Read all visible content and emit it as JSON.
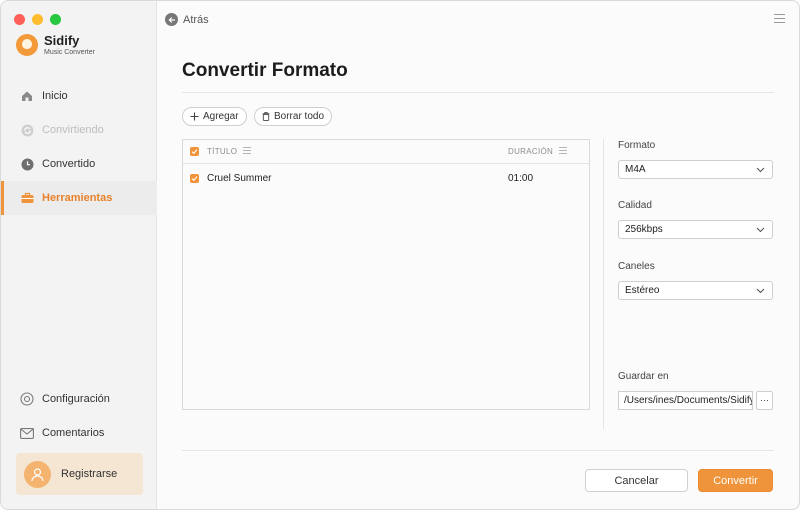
{
  "app": {
    "name": "Sidify",
    "subtitle": "Music Converter"
  },
  "sidebar": {
    "items": [
      {
        "label": "Inicio",
        "icon": "home-icon",
        "state": "normal"
      },
      {
        "label": "Convirtiendo",
        "icon": "sync-icon",
        "state": "disabled"
      },
      {
        "label": "Convertido",
        "icon": "clock-icon",
        "state": "normal"
      },
      {
        "label": "Herramientas",
        "icon": "toolbox-icon",
        "state": "active"
      }
    ],
    "bottom_items": [
      {
        "label": "Configuración",
        "icon": "gear-icon"
      },
      {
        "label": "Comentarios",
        "icon": "mail-icon"
      }
    ],
    "register_label": "Registrarse"
  },
  "topbar": {
    "back_label": "Atrás"
  },
  "page": {
    "title": "Convertir Formato"
  },
  "toolbar": {
    "add_label": "Agregar",
    "clear_label": "Borrar todo"
  },
  "table": {
    "headers": {
      "title": "TÍTULO",
      "duration": "DURACIÓN"
    },
    "rows": [
      {
        "title": "Cruel Summer",
        "duration": "01:00",
        "checked": true
      }
    ]
  },
  "settings": {
    "format": {
      "label": "Formato",
      "value": "M4A"
    },
    "quality": {
      "label": "Calidad",
      "value": "256kbps"
    },
    "channels": {
      "label": "Caneles",
      "value": "Estéreo"
    },
    "output": {
      "label": "Guardar en",
      "value": "/Users/ines/Documents/Sidify",
      "browse_label": "···"
    }
  },
  "actions": {
    "cancel_label": "Cancelar",
    "convert_label": "Convertir"
  },
  "colors": {
    "accent": "#f0943c",
    "active_text": "#e8822b",
    "register_bg": "#f5e6d3"
  }
}
